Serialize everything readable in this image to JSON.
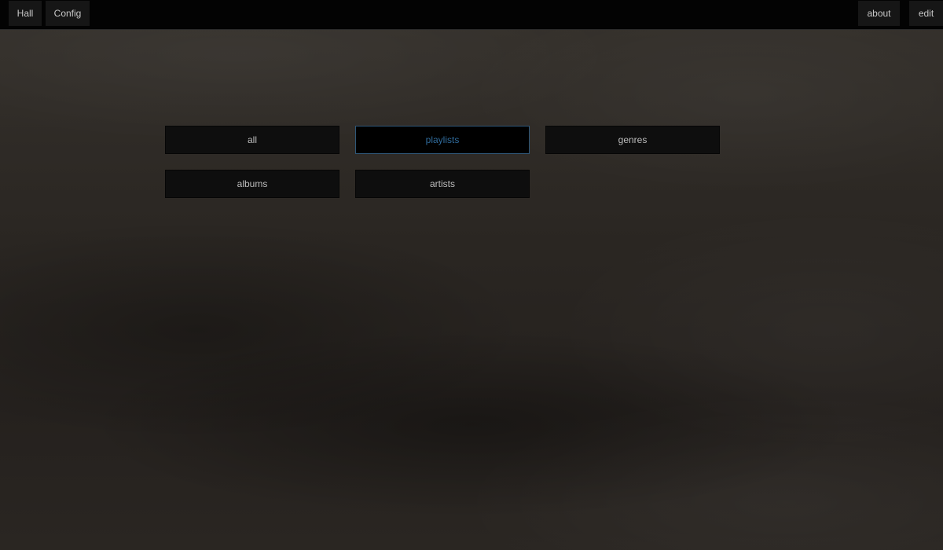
{
  "nav": {
    "left": [
      {
        "label": "Hall"
      },
      {
        "label": "Config"
      }
    ],
    "right": [
      {
        "label": "about"
      },
      {
        "label": "edit"
      }
    ]
  },
  "categories": [
    {
      "label": "all",
      "active": false
    },
    {
      "label": "playlists",
      "active": true
    },
    {
      "label": "genres",
      "active": false
    },
    {
      "label": "albums",
      "active": false
    },
    {
      "label": "artists",
      "active": false
    }
  ],
  "colors": {
    "active_text": "#2f6a9a",
    "active_border": "#2f5778",
    "button_bg": "#0e0e0e",
    "topbar_bg": "#030303"
  }
}
